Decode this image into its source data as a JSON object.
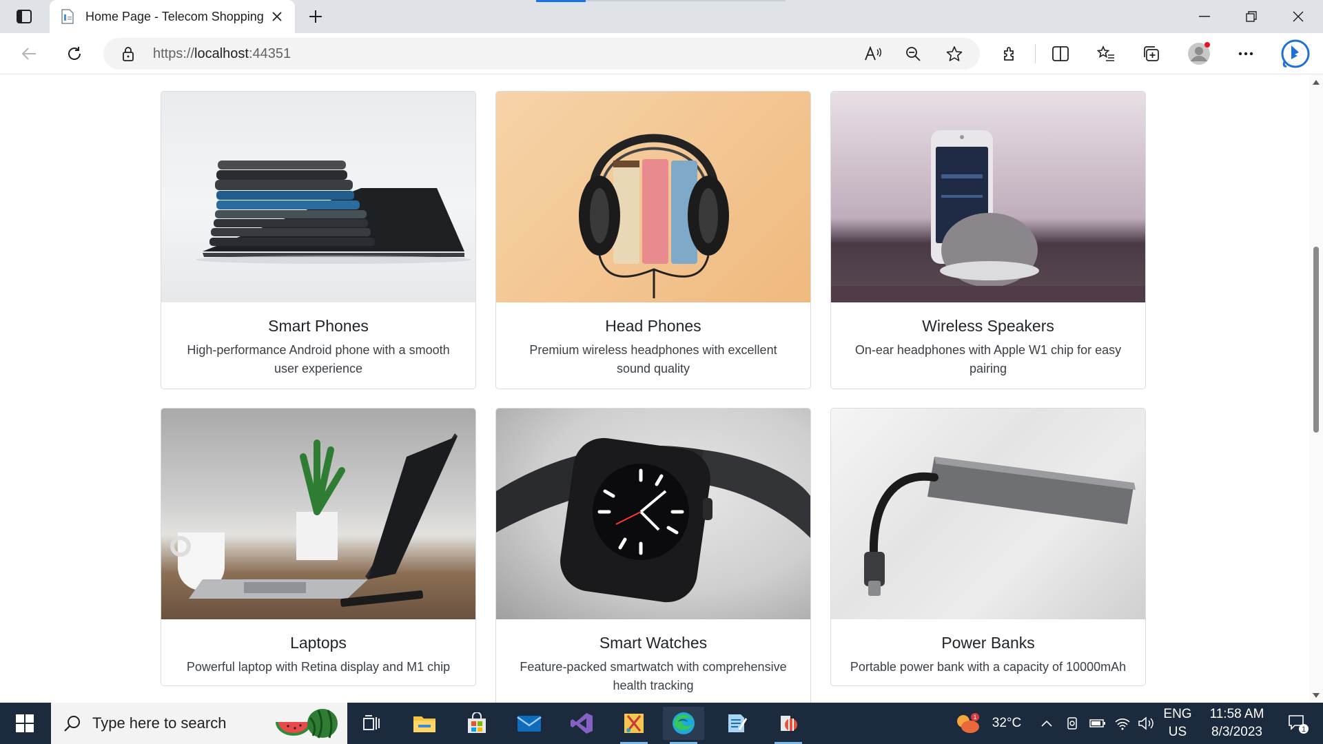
{
  "browser": {
    "tab_title": "Home Page - Telecom Shopping",
    "url_prefix": "https://",
    "url_host": "localhost",
    "url_port": ":44351"
  },
  "cards": [
    {
      "title": "Smart Phones",
      "description": "High-performance Android phone with a smooth user experience",
      "image": "phones-stack-image"
    },
    {
      "title": "Head Phones",
      "description": "Premium wireless headphones with excellent sound quality",
      "image": "headphones-books-image"
    },
    {
      "title": "Wireless Speakers",
      "description": "On-ear headphones with Apple W1 chip for easy pairing",
      "image": "speaker-phone-image"
    },
    {
      "title": "Laptops",
      "description": "Powerful laptop with Retina display and M1 chip",
      "image": "laptop-desk-image"
    },
    {
      "title": "Smart Watches",
      "description": "Feature-packed smartwatch with comprehensive health tracking",
      "image": "smartwatch-image"
    },
    {
      "title": "Power Banks",
      "description": "Portable power bank with a capacity of 10000mAh",
      "image": "powerbank-image"
    }
  ],
  "taskbar": {
    "search_placeholder": "Type here to search",
    "weather_temp": "32°C",
    "weather_badge": "1",
    "language": "ENG",
    "region": "US",
    "time": "11:58 AM",
    "date": "8/3/2023",
    "notification_count": "1"
  },
  "colors": {
    "accent": "#1a73e8",
    "taskbar": "#1c2a3d",
    "tabstrip": "#dfe3e8"
  }
}
